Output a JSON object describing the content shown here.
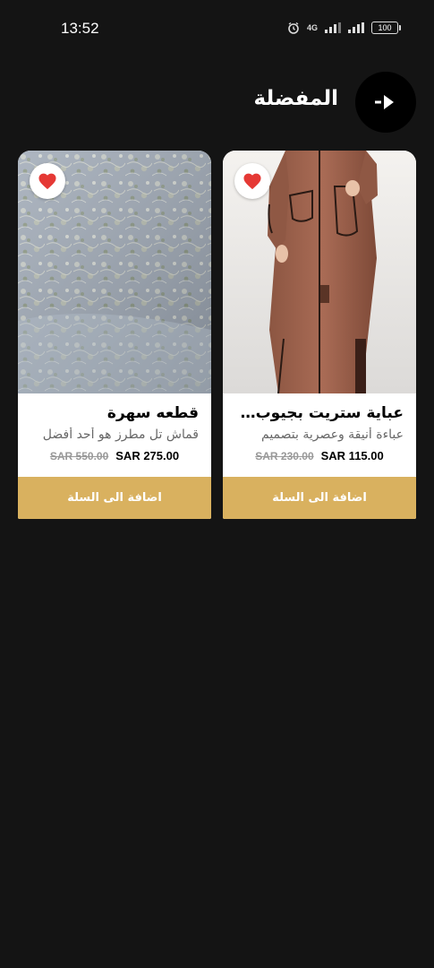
{
  "status_bar": {
    "time": "13:52",
    "network": "4G",
    "battery": "100"
  },
  "header": {
    "title": "المفضلة"
  },
  "colors": {
    "background": "#141414",
    "accent": "#d9b15f",
    "heart": "#e53935"
  },
  "products": [
    {
      "name": "عباية ستريت بجيوب مغلفة",
      "description": "عباءة أنيقة وعصرية بتصميم",
      "old_price": "SAR 230.00",
      "new_price": "SAR 115.00",
      "cta": "اضافة الى السلة",
      "icon": "heart-icon"
    },
    {
      "name": "قطعه سهرة",
      "description": "قماش تل مطرز هو أحد أفضل",
      "old_price": "SAR 550.00",
      "new_price": "SAR 275.00",
      "cta": "اضافة الى السلة",
      "icon": "heart-icon"
    }
  ]
}
